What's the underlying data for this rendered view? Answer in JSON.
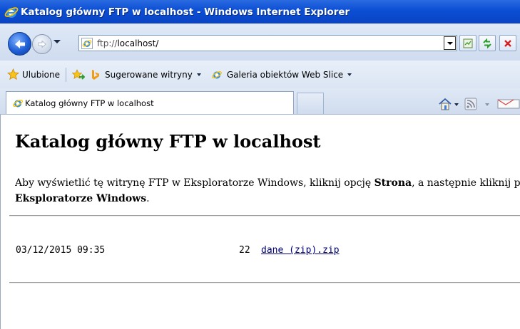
{
  "window": {
    "title": "Katalog główny FTP w localhost - Windows Internet Explorer"
  },
  "address_bar": {
    "scheme": "ftp://",
    "host": "localhost/"
  },
  "favorites_bar": {
    "favorites_label": "Ulubione",
    "suggested_sites_label": "Sugerowane witryny",
    "web_slice_label": "Galeria obiektów Web Slice"
  },
  "tab": {
    "title": "Katalog główny FTP w localhost"
  },
  "page": {
    "heading": "Katalog główny FTP w localhost",
    "info_text_1": "Aby wyświetlić tę witrynę FTP w Eksploratorze Windows, kliknij opcję ",
    "info_bold_1": "Strona",
    "info_text_2": ", a następnie kliknij polecenie Otwórz witrynę FTP w",
    "info_bold_2": "Eksploratorze Windows",
    "info_text_3": ".",
    "listing": [
      {
        "date": "03/12/2015 09:35",
        "size": "22",
        "name": "dane (zip).zip"
      }
    ]
  },
  "colors": {
    "titlebar": "#0b4ed4",
    "link": "#00007f"
  }
}
